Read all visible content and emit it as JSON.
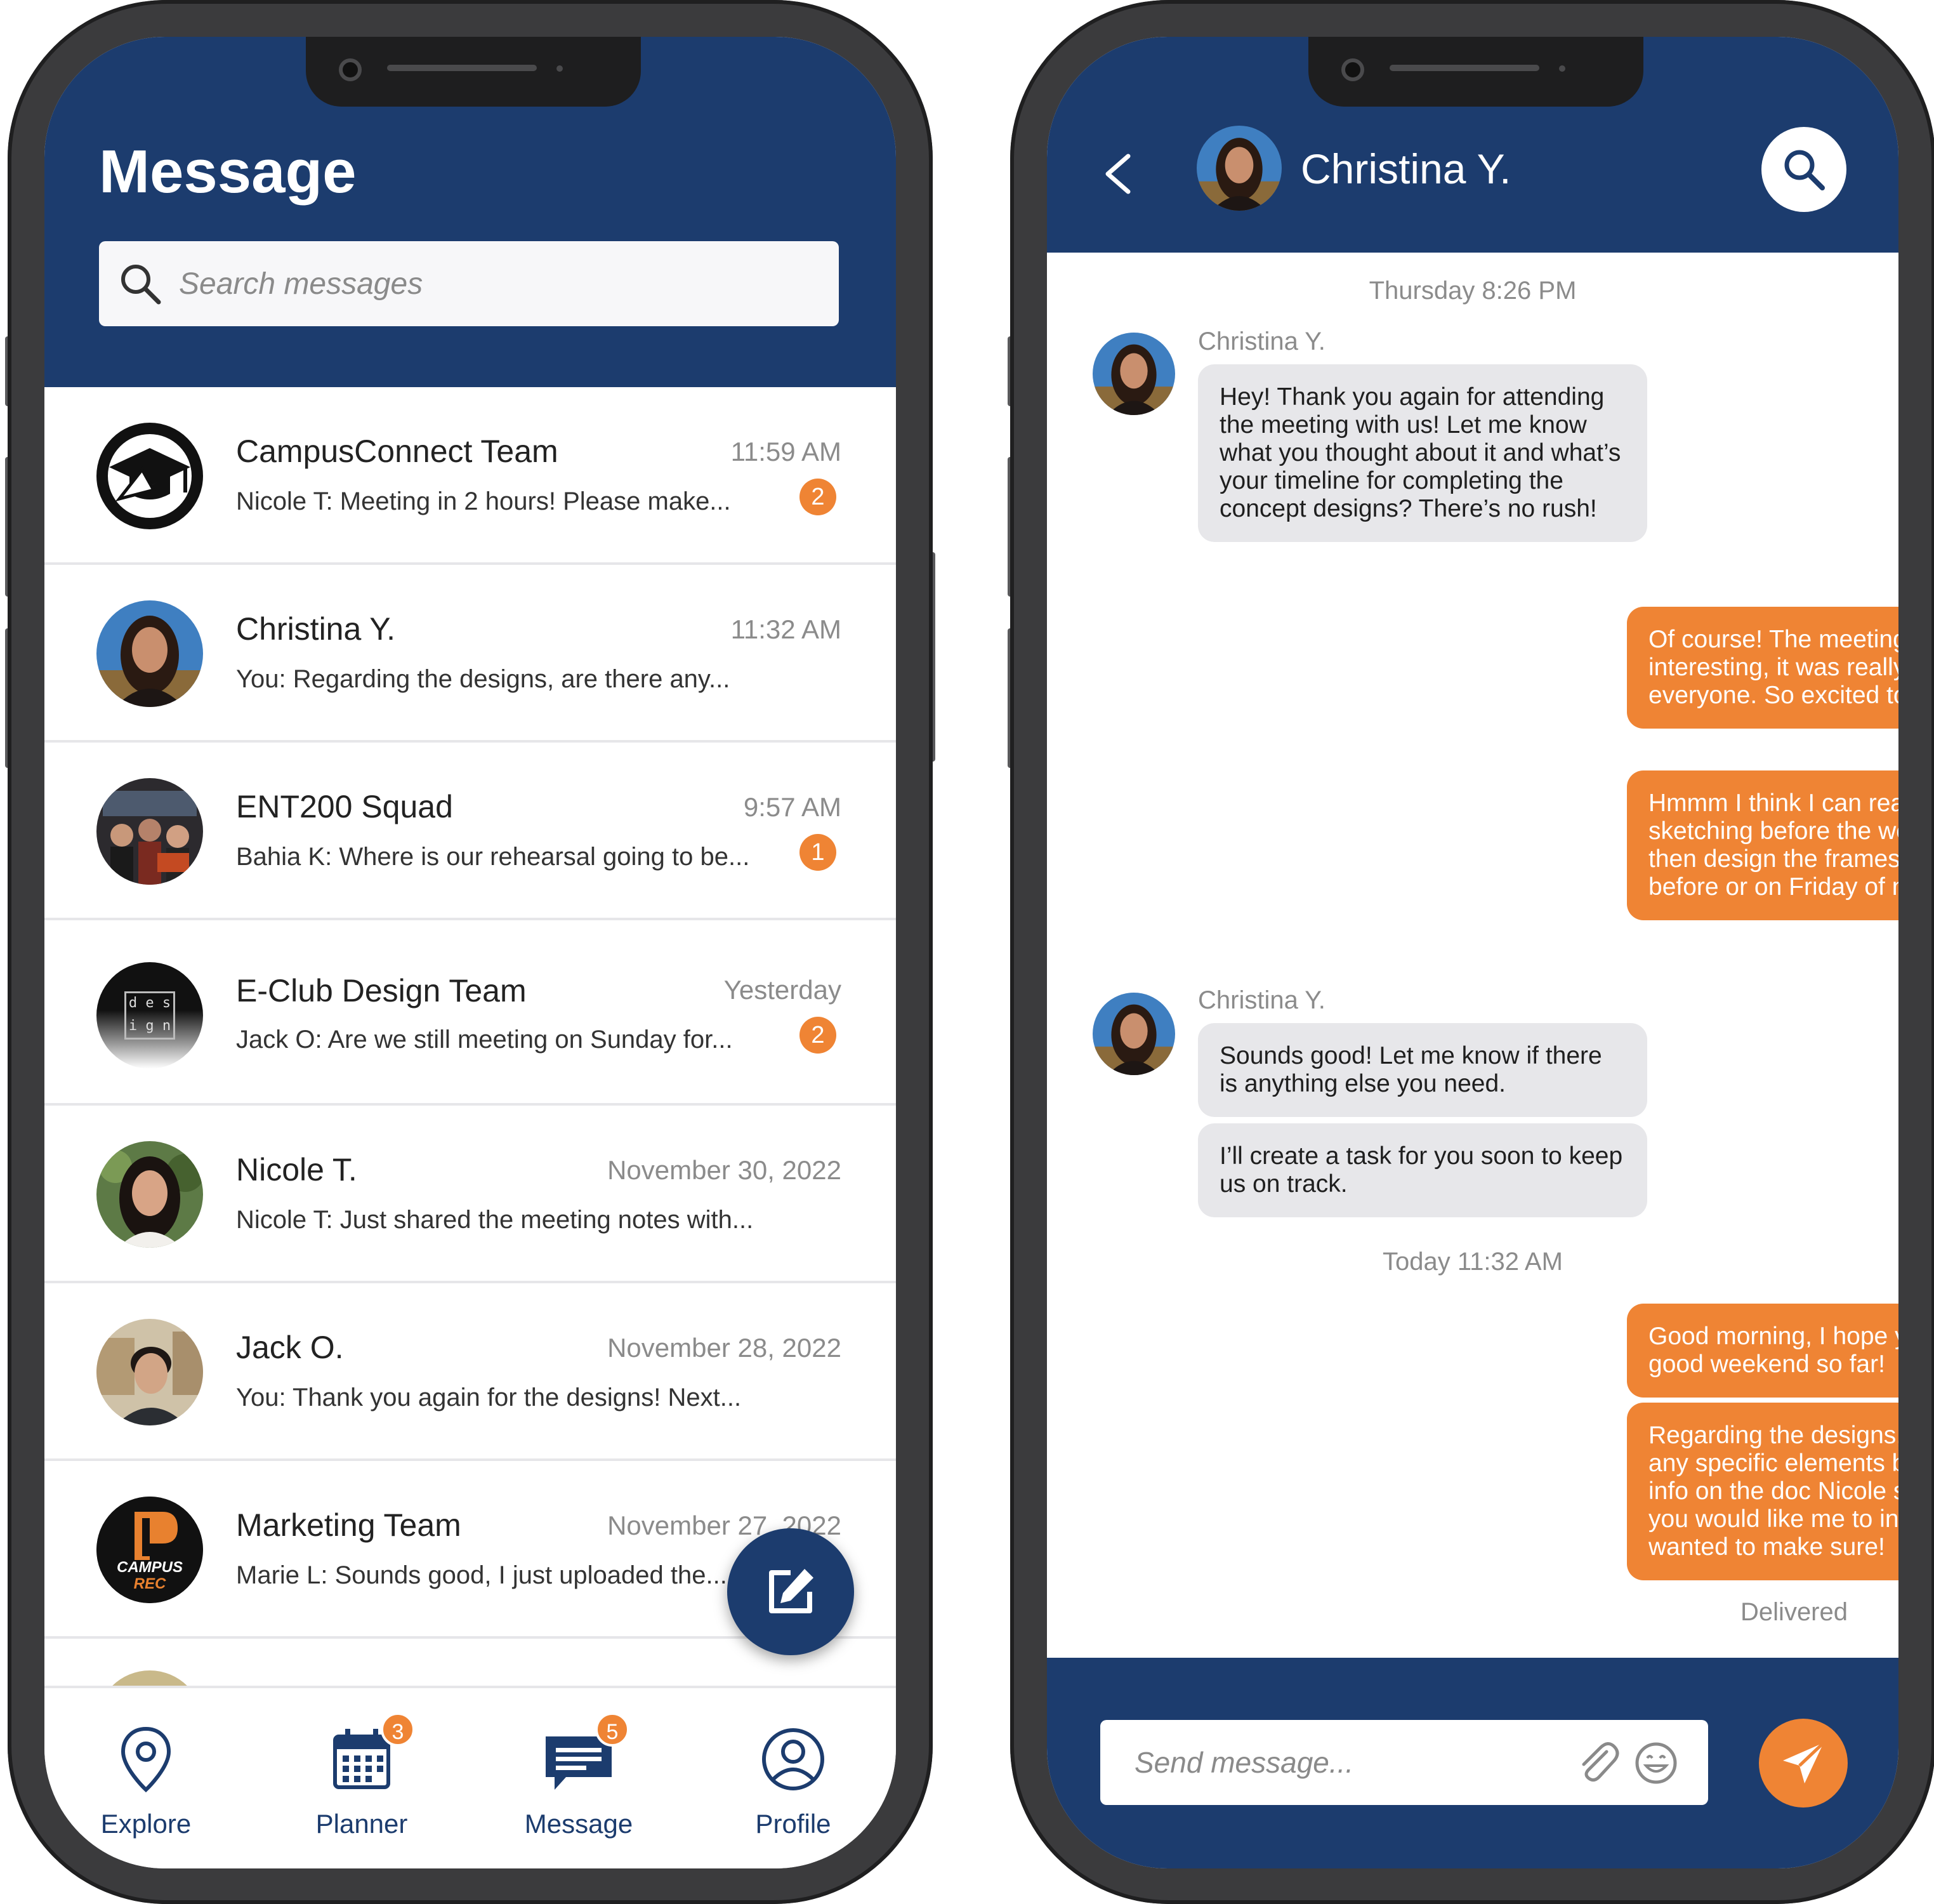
{
  "colors": {
    "navy": "#1c3c6e",
    "accent_orange": "#ef8434",
    "bubble_gray": "#e7e7ea"
  },
  "inbox": {
    "title": "Message",
    "search_placeholder": "Search messages",
    "conversations": [
      {
        "name": "CampusConnect Team",
        "time": "11:59 AM",
        "preview": "Nicole T: Meeting in 2 hours! Please make...",
        "unread": "2",
        "avatar": "graduation-cap-logo"
      },
      {
        "name": "Christina Y.",
        "time": "11:32 AM",
        "preview": "You: Regarding the designs, are there any...",
        "unread": "",
        "avatar": "user-photo"
      },
      {
        "name": "ENT200 Squad",
        "time": "9:57 AM",
        "preview": "Bahia K: Where is our rehearsal going to be...",
        "unread": "1",
        "avatar": "group-photo"
      },
      {
        "name": "E-Club Design Team",
        "time": "Yesterday",
        "preview": "Jack O: Are we still meeting on Sunday for...",
        "unread": "2",
        "avatar": "design-logo",
        "avatar_text": [
          "d e s",
          "i g n"
        ]
      },
      {
        "name": "Nicole T.",
        "time": "November 30, 2022",
        "preview": "Nicole T: Just shared the meeting notes with...",
        "unread": "",
        "avatar": "user-photo"
      },
      {
        "name": "Jack O.",
        "time": "November 28, 2022",
        "preview": "You: Thank you again for the designs! Next...",
        "unread": "",
        "avatar": "user-photo"
      },
      {
        "name": "Marketing Team",
        "time": "November 27, 2022",
        "preview": "Marie L: Sounds good, I just uploaded the...",
        "unread": "",
        "avatar": "campus-rec-logo",
        "avatar_text": [
          "CAMPUS",
          "REC"
        ]
      }
    ],
    "tabs": [
      {
        "label": "Explore",
        "icon": "map-pin-icon",
        "badge": ""
      },
      {
        "label": "Planner",
        "icon": "calendar-icon",
        "badge": "3"
      },
      {
        "label": "Message",
        "icon": "chat-icon",
        "badge": "5"
      },
      {
        "label": "Profile",
        "icon": "user-circle-icon",
        "badge": ""
      }
    ],
    "compose_icon": "edit-icon"
  },
  "chat": {
    "contact_name": "Christina Y.",
    "back_label": "<",
    "stamp_1": "Thursday 8:26 PM",
    "stamp_2": "Today 11:32 AM",
    "sender_label": "Christina Y.",
    "messages": [
      {
        "from": "them",
        "text": "Hey! Thank you again for attending the meeting with us! Let me know what you thought about it and what’s your timeline for completing the concept designs? There’s no rush!"
      },
      {
        "from": "me",
        "text": "Of course! The meeting was interesting, it was really nice meeting everyone. So excited to get started!"
      },
      {
        "from": "me",
        "text": "Hmmm I think I can realistically start sketching before the weekend and then design the frames on Figma before or on Friday of next week?"
      },
      {
        "from": "them",
        "text": "Sounds good! Let me know if there is anything else you need."
      },
      {
        "from": "them",
        "text": "I’ll create a task for you soon to keep us on track."
      },
      {
        "from": "me",
        "text": "Good morning, I hope you had a good weekend so far!"
      },
      {
        "from": "me",
        "text": "Regarding the designs, are there any specific elements beyond the info on the doc Nicole shared that you would like me to include? Just wanted to make sure!"
      }
    ],
    "status": "Delivered",
    "composer_placeholder": "Send message...",
    "composer_icons": [
      "paperclip-icon",
      "emoji-icon",
      "send-icon"
    ]
  }
}
